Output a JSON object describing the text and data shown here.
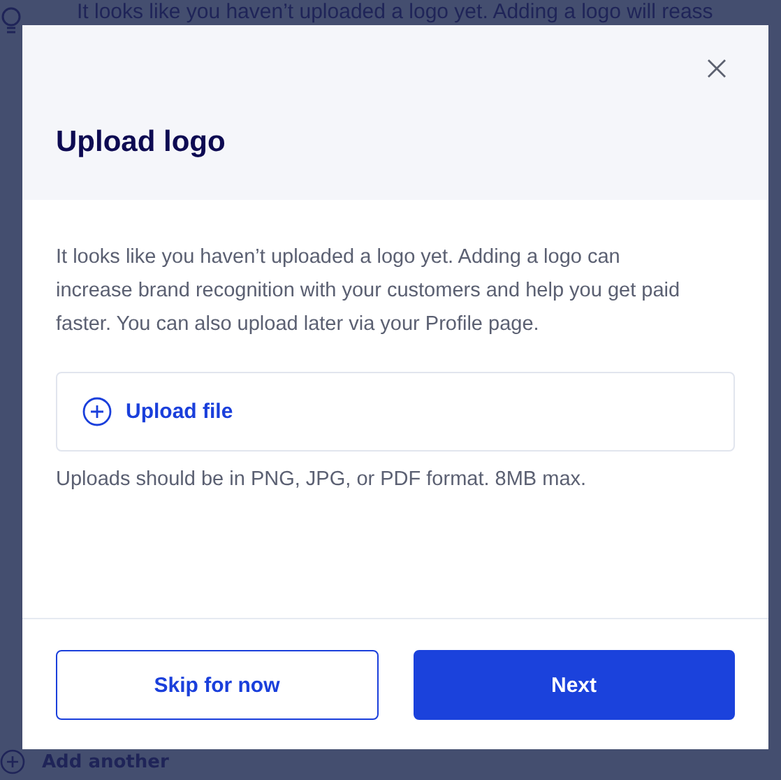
{
  "background": {
    "banner_text": "It looks like you haven’t uploaded a logo yet. Adding a logo will reass",
    "add_link": "Add another"
  },
  "modal": {
    "title": "Upload logo",
    "description": "It looks like you haven’t uploaded a logo yet. Adding a logo can increase brand recognition with your customers and help you get paid faster. You can also upload later via your Profile page.",
    "upload_label": "Upload file",
    "hint": "Uploads should be in PNG, JPG, or PDF format. 8MB max.",
    "buttons": [
      {
        "label": "Skip for now",
        "kind": "secondary"
      },
      {
        "label": "Next",
        "kind": "primary"
      }
    ]
  }
}
